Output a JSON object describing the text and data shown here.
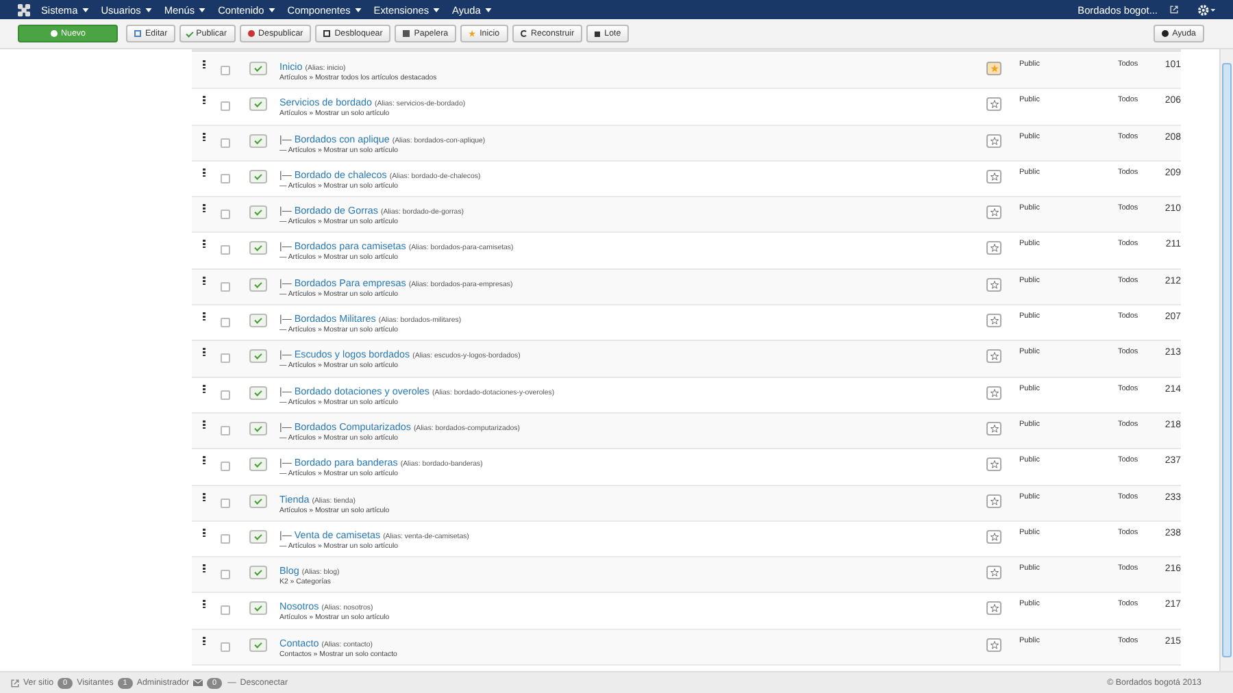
{
  "navbar": {
    "menus": [
      "Sistema",
      "Usuarios",
      "Menús",
      "Contenido",
      "Componentes",
      "Extensiones",
      "Ayuda"
    ],
    "site_link": "Bordados bogot..."
  },
  "toolbar": {
    "buttons": [
      {
        "kind": "new",
        "label": "Nuevo"
      },
      {
        "kind": "edit",
        "label": "Editar"
      },
      {
        "kind": "publish",
        "label": "Publicar"
      },
      {
        "kind": "unpublish",
        "label": "Despublicar"
      },
      {
        "kind": "checkin",
        "label": "Desbloquear"
      },
      {
        "kind": "trash",
        "label": "Papelera"
      },
      {
        "kind": "home",
        "label": "Inicio"
      },
      {
        "kind": "rebuild",
        "label": "Reconstruir"
      },
      {
        "kind": "batch",
        "label": "Lote"
      }
    ],
    "help": "Ayuda"
  },
  "items": [
    {
      "title": "Inicio",
      "alias": "(Alias: inicio)",
      "note": "Artículos » Mostrar todos los artículos destacados",
      "selected": false,
      "published": true,
      "home": true,
      "access": "Public",
      "language": "Todos",
      "id": "101"
    },
    {
      "title": "Servicios de bordado",
      "alias": "(Alias: servicios-de-bordado)",
      "note": "Artículos » Mostrar un solo artículo",
      "selected": false,
      "published": true,
      "home": false,
      "access": "Public",
      "language": "Todos",
      "id": "206",
      "children": [
        {
          "prefix": "|—",
          "title": "Bordados con aplique",
          "alias": "(Alias: bordados-con-aplique)",
          "note": "— Artículos » Mostrar un solo artículo",
          "selected": false,
          "published": true,
          "home": false,
          "access": "Public",
          "language": "Todos",
          "id": "208"
        },
        {
          "prefix": "|—",
          "title": "Bordado de chalecos",
          "alias": "(Alias: bordado-de-chalecos)",
          "note": "— Artículos » Mostrar un solo artículo",
          "selected": false,
          "published": true,
          "home": false,
          "access": "Public",
          "language": "Todos",
          "id": "209"
        },
        {
          "prefix": "|—",
          "title": "Bordado de Gorras",
          "alias": "(Alias: bordado-de-gorras)",
          "note": "— Artículos » Mostrar un solo artículo",
          "selected": false,
          "published": true,
          "home": false,
          "access": "Public",
          "language": "Todos",
          "id": "210"
        },
        {
          "prefix": "|—",
          "title": "Bordados para camisetas",
          "alias": "(Alias: bordados-para-camisetas)",
          "note": "— Artículos » Mostrar un solo artículo",
          "selected": false,
          "published": true,
          "home": false,
          "access": "Public",
          "language": "Todos",
          "id": "211"
        },
        {
          "prefix": "|—",
          "title": "Bordados Para empresas",
          "alias": "(Alias: bordados-para-empresas)",
          "note": "— Artículos » Mostrar un solo artículo",
          "selected": false,
          "published": true,
          "home": false,
          "access": "Public",
          "language": "Todos",
          "id": "212"
        },
        {
          "prefix": "|—",
          "title": "Bordados Militares",
          "alias": "(Alias: bordados-militares)",
          "note": "— Artículos » Mostrar un solo artículo",
          "selected": false,
          "published": true,
          "home": false,
          "access": "Public",
          "language": "Todos",
          "id": "207"
        },
        {
          "prefix": "|—",
          "title": "Escudos y logos bordados",
          "alias": "(Alias: escudos-y-logos-bordados)",
          "note": "— Artículos » Mostrar un solo artículo",
          "selected": false,
          "published": true,
          "home": false,
          "access": "Public",
          "language": "Todos",
          "id": "213"
        },
        {
          "prefix": "|—",
          "title": "Bordado dotaciones y overoles",
          "alias": "(Alias: bordado-dotaciones-y-overoles)",
          "note": "— Artículos » Mostrar un solo artículo",
          "selected": false,
          "published": true,
          "home": false,
          "access": "Public",
          "language": "Todos",
          "id": "214"
        },
        {
          "prefix": "|—",
          "title": "Bordados Computarizados",
          "alias": "(Alias: bordados-computarizados)",
          "note": "— Artículos » Mostrar un solo artículo",
          "selected": false,
          "published": true,
          "home": false,
          "access": "Public",
          "language": "Todos",
          "id": "218"
        },
        {
          "prefix": "|—",
          "title": "Bordado para banderas",
          "alias": "(Alias: bordado-banderas)",
          "note": "— Artículos » Mostrar un solo artículo",
          "selected": false,
          "published": true,
          "home": false,
          "access": "Public",
          "language": "Todos",
          "id": "237"
        }
      ]
    },
    {
      "title": "Tienda",
      "alias": "(Alias: tienda)",
      "note": "Artículos » Mostrar un solo artículo",
      "selected": false,
      "published": true,
      "home": false,
      "access": "Public",
      "language": "Todos",
      "id": "233",
      "children": [
        {
          "prefix": "|—",
          "title": "Venta de camisetas",
          "alias": "(Alias: venta-de-camisetas)",
          "note": "— Artículos » Mostrar un solo artículo",
          "selected": false,
          "published": true,
          "home": false,
          "access": "Public",
          "language": "Todos",
          "id": "238"
        }
      ]
    },
    {
      "title": "Blog",
      "alias": "(Alias: blog)",
      "note": "K2 » Categorías",
      "selected": false,
      "published": true,
      "home": false,
      "access": "Public",
      "language": "Todos",
      "id": "216"
    },
    {
      "title": "Nosotros",
      "alias": "(Alias: nosotros)",
      "note": "Artículos » Mostrar un solo artículo",
      "selected": false,
      "published": true,
      "home": false,
      "access": "Public",
      "language": "Todos",
      "id": "217"
    },
    {
      "title": "Contacto",
      "alias": "(Alias: contacto)",
      "note": "Contactos » Mostrar un solo contacto",
      "selected": false,
      "published": true,
      "home": false,
      "access": "Public",
      "language": "Todos",
      "id": "215"
    }
  ],
  "status_bar": {
    "view_site": "Ver sitio",
    "visitors_count": "0",
    "visitors_label": "Visitantes",
    "admins_count": "1",
    "admins_label": "Administrador",
    "messages_count": "0",
    "separator": "—",
    "logout": "Desconectar",
    "copyright": "© Bordados bogotá 2013"
  }
}
